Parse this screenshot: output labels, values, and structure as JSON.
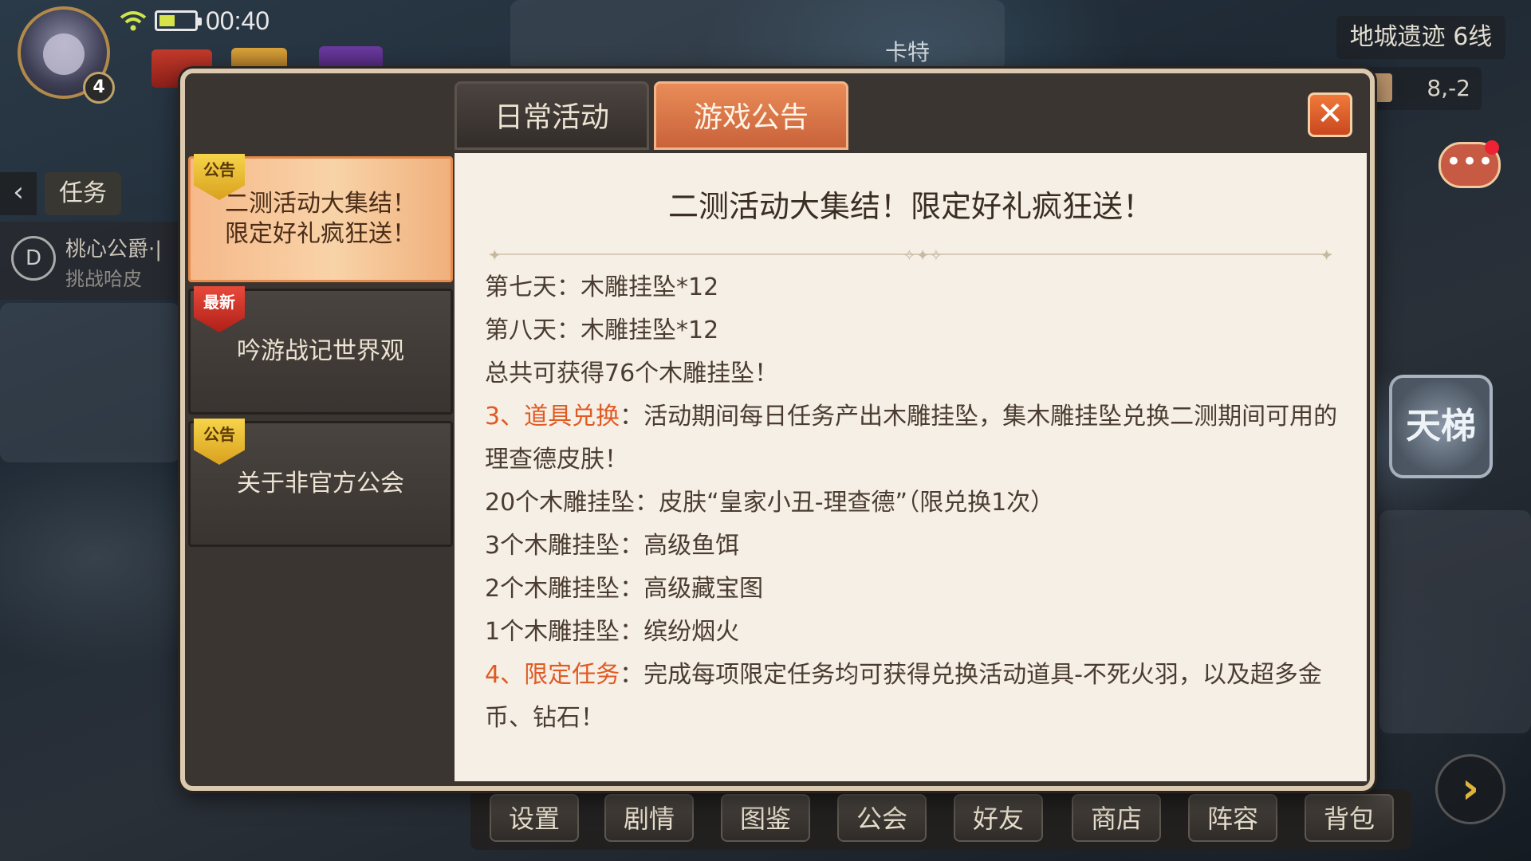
{
  "hud": {
    "level": "4",
    "time": "00:40",
    "location": "地城遗迹 6线",
    "coords": "8,-2",
    "ladder_label": "天梯",
    "npc_name": "卡特"
  },
  "quest": {
    "back_icon": "‹",
    "tab_label": "任务",
    "title": "桃心公爵·|",
    "subtitle": "挑战哈皮",
    "icon_glyph": "D"
  },
  "bottom_menu": [
    "设置",
    "剧情",
    "图鉴",
    "公会",
    "好友",
    "商店",
    "阵容",
    "背包"
  ],
  "dialog": {
    "tabs": {
      "daily": "日常活动",
      "notice": "游戏公告"
    },
    "close_glyph": "✕",
    "side_items": [
      {
        "tag": "公告",
        "label_line1": "二测活动大集结！",
        "label_line2": "限定好礼疯狂送！",
        "tag_color": "gold",
        "active": true
      },
      {
        "tag": "最新",
        "label_line1": "吟游战记世界观",
        "label_line2": "",
        "tag_color": "red",
        "active": false
      },
      {
        "tag": "公告",
        "label_line1": "关于非官方公会",
        "label_line2": "",
        "tag_color": "gold",
        "active": false
      }
    ],
    "content": {
      "title": "二测活动大集结！限定好礼疯狂送！",
      "lines": [
        "第七天：木雕挂坠*12",
        "第八天：木雕挂坠*12",
        "总共可获得76个木雕挂坠！"
      ],
      "section3_head": "3、道具兑换",
      "section3_body": "：活动期间每日任务产出木雕挂坠，集木雕挂坠兑换二测期间可用的理查德皮肤！",
      "rewards": [
        "20个木雕挂坠：皮肤“皇家小丑-理查德”（限兑换1次）",
        "3个木雕挂坠：高级鱼饵",
        "2个木雕挂坠：高级藏宝图",
        "1个木雕挂坠：缤纷烟火"
      ],
      "section4_head": "4、限定任务",
      "section4_body": "：完成每项限定任务均可获得兑换活动道具-不死火羽，以及超多金币、钻石！"
    }
  },
  "colors": {
    "accent_orange": "#e05a24",
    "tab_active": "#e98c58",
    "panel_bg": "#f6efe5",
    "dialog_border": "#dccab0"
  }
}
